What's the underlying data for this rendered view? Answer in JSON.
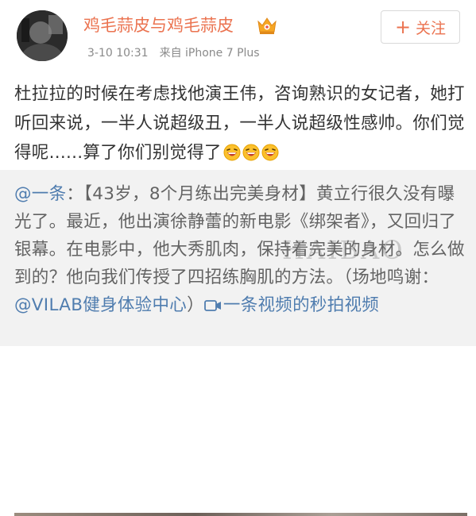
{
  "user": {
    "name": "鸡毛蒜皮与鸡毛蒜皮",
    "badge_icon": "crown-vip-icon",
    "follow_label": "关注",
    "follow_prefix": "+"
  },
  "meta": {
    "timestamp": "3-10 10:31",
    "source": "来自 iPhone 7 Plus"
  },
  "post": {
    "text": "杜拉拉的时候在考虑找他演王伟，咨询熟识的女记者，她打听回来说，一半人说超级丑，一半人说超级性感帅。你们觉得呢......算了你们别觉得了",
    "emoji_icon": "laughing-emoji-icon",
    "emoji_count": 3
  },
  "repost": {
    "mention": "@一条",
    "body": "：【43岁，8个月练出完美身材】黄立行很久没有曝光了。最近，他出演徐静蕾的新电影《绑架者》，又回归了银幕。在电影中，他大秀肌肉，保持着完美的身材。怎么做到的？他向我们传授了四招练胸肌的方法。（场地鸣谢：",
    "mention2": "@VILAB健身体验中心",
    "close_paren": "）",
    "video_link": "一条视频的秒拍视频",
    "video_icon": "video-camera-icon"
  },
  "watermark": "HAIBAO",
  "colors": {
    "accent": "#eb7350",
    "link": "#507daf",
    "repost_bg": "#f2f2f2"
  }
}
